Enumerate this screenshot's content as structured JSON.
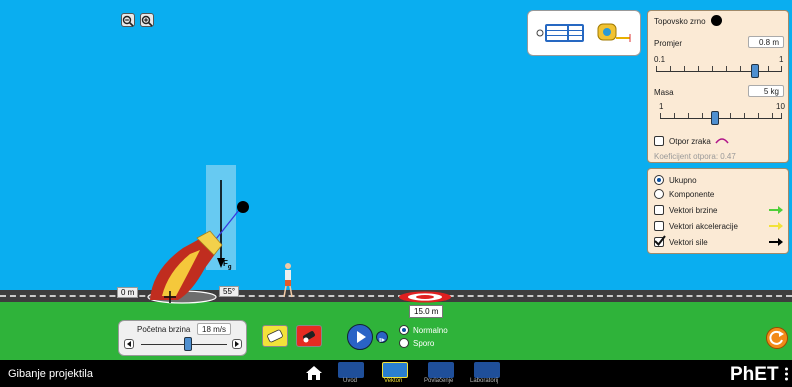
{
  "zoom": {
    "zoom_out_icon": "zoom-out-icon",
    "zoom_in_icon": "zoom-in-icon"
  },
  "projectile_panel": {
    "title": "Topovsko zrno",
    "diameter_label": "Promjer",
    "diameter_value": "0.8 m",
    "diameter_min": "0.1",
    "diameter_max": "1",
    "diameter_level": 0.78,
    "mass_label": "Masa",
    "mass_value": "5 kg",
    "mass_min": "1",
    "mass_max": "10",
    "mass_level": 0.44,
    "air_resistance_label": "Otpor zraka",
    "drag_coefficient_label": "Koeficijent otpora: 0.47"
  },
  "vectors_panel": {
    "total_label": "Ukupno",
    "components_label": "Komponente",
    "velocity_vectors_label": "Vektori brzine",
    "acceleration_vectors_label": "Vektori akceleracije",
    "force_vectors_label": "Vektori sile",
    "velocity_color": "#4fcf3a",
    "acceleration_color": "#f2e23a",
    "force_color": "#000000"
  },
  "scene": {
    "cannon_height": "0 m",
    "cannon_angle": "55°",
    "gravity_label": "F",
    "gravity_subscript": "g",
    "target_distance": "15.0 m"
  },
  "launch_panel": {
    "initial_speed_label": "Početna brzina",
    "initial_speed_value": "18 m/s",
    "speed_level": 0.62
  },
  "playback": {
    "normal_label": "Normalno",
    "slow_label": "Sporo"
  },
  "navbar": {
    "app_title": "Gibanje projektila",
    "tabs": [
      "Uvod",
      "Vektori",
      "Povlačenje",
      "Laboratorij"
    ],
    "active_tab": "Vektori",
    "brand": "PhET"
  },
  "colors": {
    "sky": "#0aaef0",
    "ground": "#2fb33a",
    "panel": "#fbead5",
    "accent_active": "#f2e23a"
  }
}
